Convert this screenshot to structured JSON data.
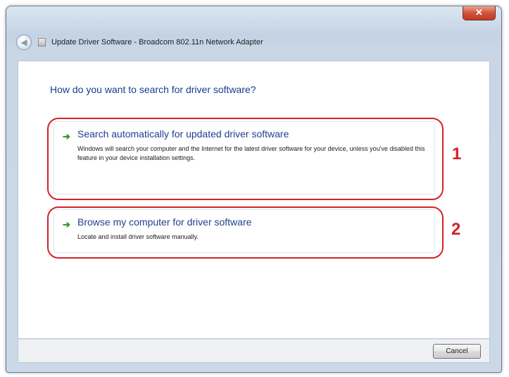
{
  "window": {
    "title": "Update Driver Software - Broadcom 802.11n Network Adapter",
    "close_glyph": "✕",
    "back_glyph": "◀"
  },
  "main": {
    "heading": "How do you want to search for driver software?",
    "options": [
      {
        "arrow": "➔",
        "title": "Search automatically for updated driver software",
        "description": "Windows will search your computer and the Internet for the latest driver software for your device, unless you've disabled this feature in your device installation settings.",
        "callout_number": "1"
      },
      {
        "arrow": "➔",
        "title": "Browse my computer for driver software",
        "description": "Locate and install driver software manually.",
        "callout_number": "2"
      }
    ]
  },
  "footer": {
    "cancel_label": "Cancel"
  },
  "colors": {
    "heading": "#1a3d8c",
    "callout": "#d2232a",
    "arrow": "#2f9a2f"
  }
}
